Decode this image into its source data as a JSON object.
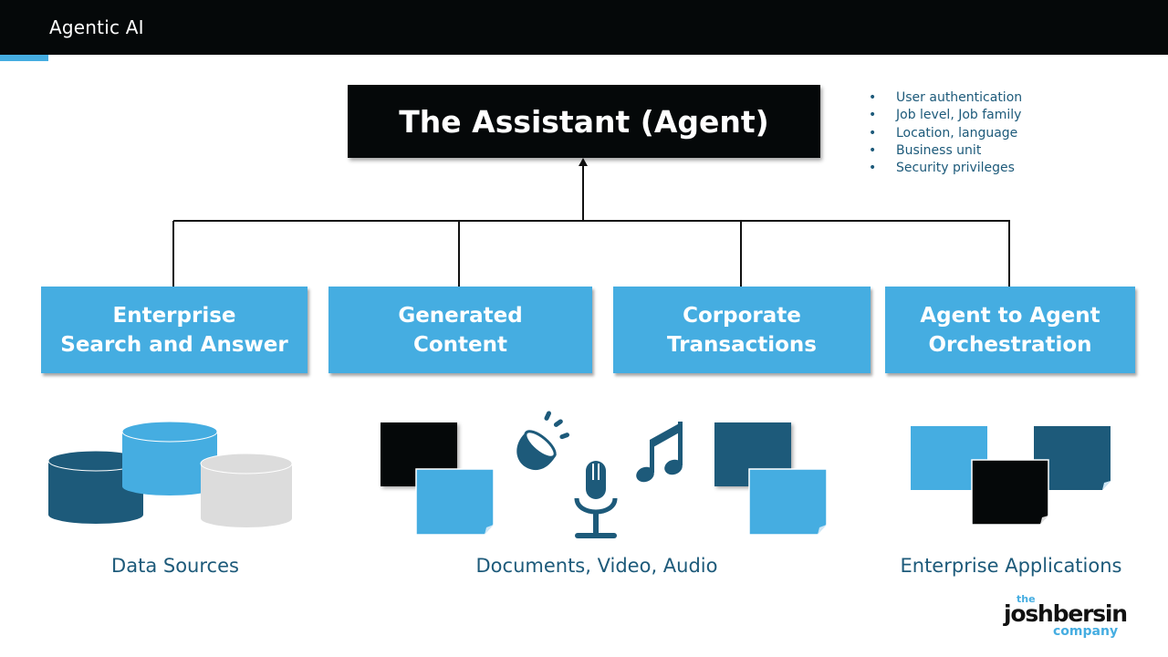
{
  "header": {
    "title": "Agentic AI"
  },
  "colors": {
    "black": "#050809",
    "light_blue": "#45ade1",
    "dark_blue": "#1d5a7a",
    "gray": "#dcdcdc"
  },
  "agent": {
    "title": "The Assistant (Agent)",
    "attributes": [
      "User authentication",
      "Job level, Job family",
      "Location, language",
      "Business unit",
      "Security privileges"
    ],
    "bullet": "•"
  },
  "capabilities": [
    {
      "label": "Enterprise\nSearch and Answer"
    },
    {
      "label": "Generated\nContent"
    },
    {
      "label": "Corporate\nTransactions"
    },
    {
      "label": "Agent to Agent\nOrchestration"
    }
  ],
  "sources": [
    {
      "label": "Data Sources",
      "icon": "database-cylinders-icon"
    },
    {
      "label": "Documents, Video, Audio",
      "icon": "media-icons"
    },
    {
      "label": "Enterprise Applications",
      "icon": "app-windows-icon"
    }
  ],
  "logo": {
    "the": "the",
    "name": "joshbersin",
    "company": "company"
  }
}
